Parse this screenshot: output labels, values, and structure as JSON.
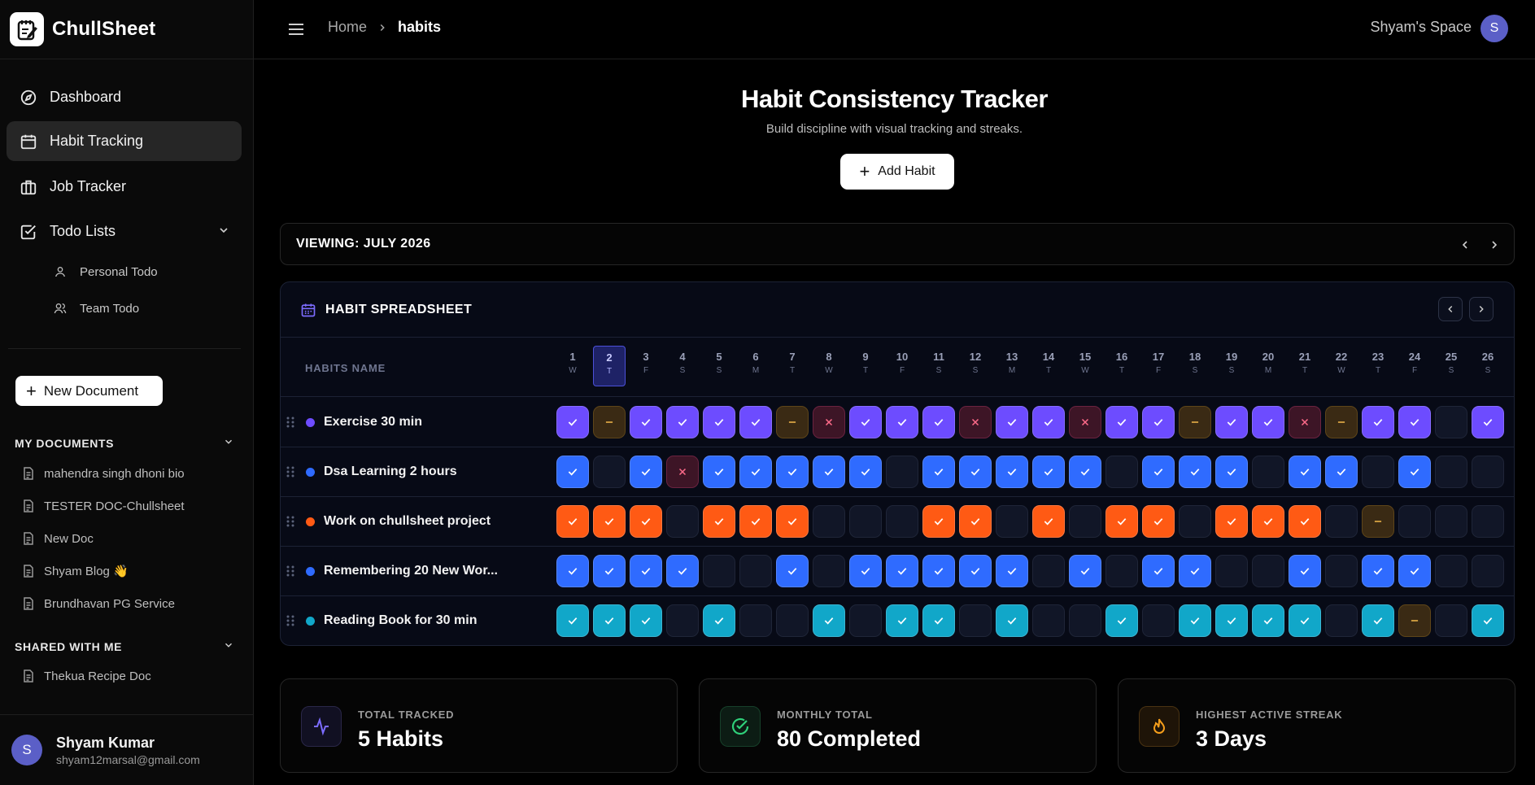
{
  "brand": {
    "name": "ChullSheet"
  },
  "sidebar": {
    "nav": [
      {
        "label": "Dashboard",
        "icon": "compass-icon"
      },
      {
        "label": "Habit Tracking",
        "icon": "calendar-icon",
        "active": true
      },
      {
        "label": "Job Tracker",
        "icon": "briefcase-icon"
      },
      {
        "label": "Todo Lists",
        "icon": "checkbox-icon"
      }
    ],
    "todo_sub": [
      {
        "label": "Personal Todo",
        "icon": "user-icon"
      },
      {
        "label": "Team Todo",
        "icon": "users-icon"
      }
    ],
    "new_document": "New Document",
    "my_documents": {
      "title": "MY DOCUMENTS",
      "items": [
        "mahendra singh dhoni bio",
        "TESTER DOC-Chullsheet",
        "New Doc",
        "Shyam Blog 👋",
        "Brundhavan PG Service"
      ]
    },
    "shared": {
      "title": "SHARED WITH ME",
      "items": [
        "Thekua Recipe Doc"
      ]
    },
    "user": {
      "initial": "S",
      "name": "Shyam Kumar",
      "email": "shyam12marsal@gmail.com"
    }
  },
  "header": {
    "breadcrumb_home": "Home",
    "breadcrumb_current": "habits",
    "space_name": "Shyam's Space",
    "space_initial": "S"
  },
  "page": {
    "title": "Habit Consistency Tracker",
    "subtitle": "Build discipline with visual tracking and streaks.",
    "add_habit": "Add Habit",
    "viewing": "VIEWING: JULY 2026"
  },
  "sheet": {
    "title": "HABIT SPREADSHEET",
    "habits_column": "HABITS NAME",
    "today": 2,
    "days": [
      {
        "n": "1",
        "w": "W"
      },
      {
        "n": "2",
        "w": "T"
      },
      {
        "n": "3",
        "w": "F"
      },
      {
        "n": "4",
        "w": "S"
      },
      {
        "n": "5",
        "w": "S"
      },
      {
        "n": "6",
        "w": "M"
      },
      {
        "n": "7",
        "w": "T"
      },
      {
        "n": "8",
        "w": "W"
      },
      {
        "n": "9",
        "w": "T"
      },
      {
        "n": "10",
        "w": "F"
      },
      {
        "n": "11",
        "w": "S"
      },
      {
        "n": "12",
        "w": "S"
      },
      {
        "n": "13",
        "w": "M"
      },
      {
        "n": "14",
        "w": "T"
      },
      {
        "n": "15",
        "w": "W"
      },
      {
        "n": "16",
        "w": "T"
      },
      {
        "n": "17",
        "w": "F"
      },
      {
        "n": "18",
        "w": "S"
      },
      {
        "n": "19",
        "w": "S"
      },
      {
        "n": "20",
        "w": "M"
      },
      {
        "n": "21",
        "w": "T"
      },
      {
        "n": "22",
        "w": "W"
      },
      {
        "n": "23",
        "w": "T"
      },
      {
        "n": "24",
        "w": "F"
      },
      {
        "n": "25",
        "w": "S"
      },
      {
        "n": "26",
        "w": "S"
      }
    ],
    "habits": [
      {
        "name": "Exercise 30 min",
        "color": "#6d4cff",
        "cells": "csccccsxcccxccxccsccxscc.c"
      },
      {
        "name": "Dsa Learning 2 hours",
        "color": "#2f6bff",
        "cells": "c.cxccccc.ccccc.ccc.cc.c.."
      },
      {
        "name": "Work on chullsheet project",
        "color": "#ff5a14",
        "cells": "ccc.ccc...cc.c.cc.ccc.s..."
      },
      {
        "name": "Remembering 20 New Wor...",
        "color": "#2f6bff",
        "cells": "cccc..c.ccccc.c.cc..c.cc.."
      },
      {
        "name": "Reading Book for 30 min",
        "color": "#11a7c9",
        "cells": "ccc.c..c.cc.c..c.cccc.cs.c"
      }
    ]
  },
  "stats": [
    {
      "label": "TOTAL TRACKED",
      "value": "5 Habits",
      "icon": "activity-icon",
      "color": "#7c6cff"
    },
    {
      "label": "MONTHLY TOTAL",
      "value": "80 Completed",
      "icon": "check-circle-icon",
      "color": "#2fd07a"
    },
    {
      "label": "HIGHEST ACTIVE STREAK",
      "value": "3 Days",
      "icon": "flame-icon",
      "color": "#f59e1b"
    }
  ]
}
